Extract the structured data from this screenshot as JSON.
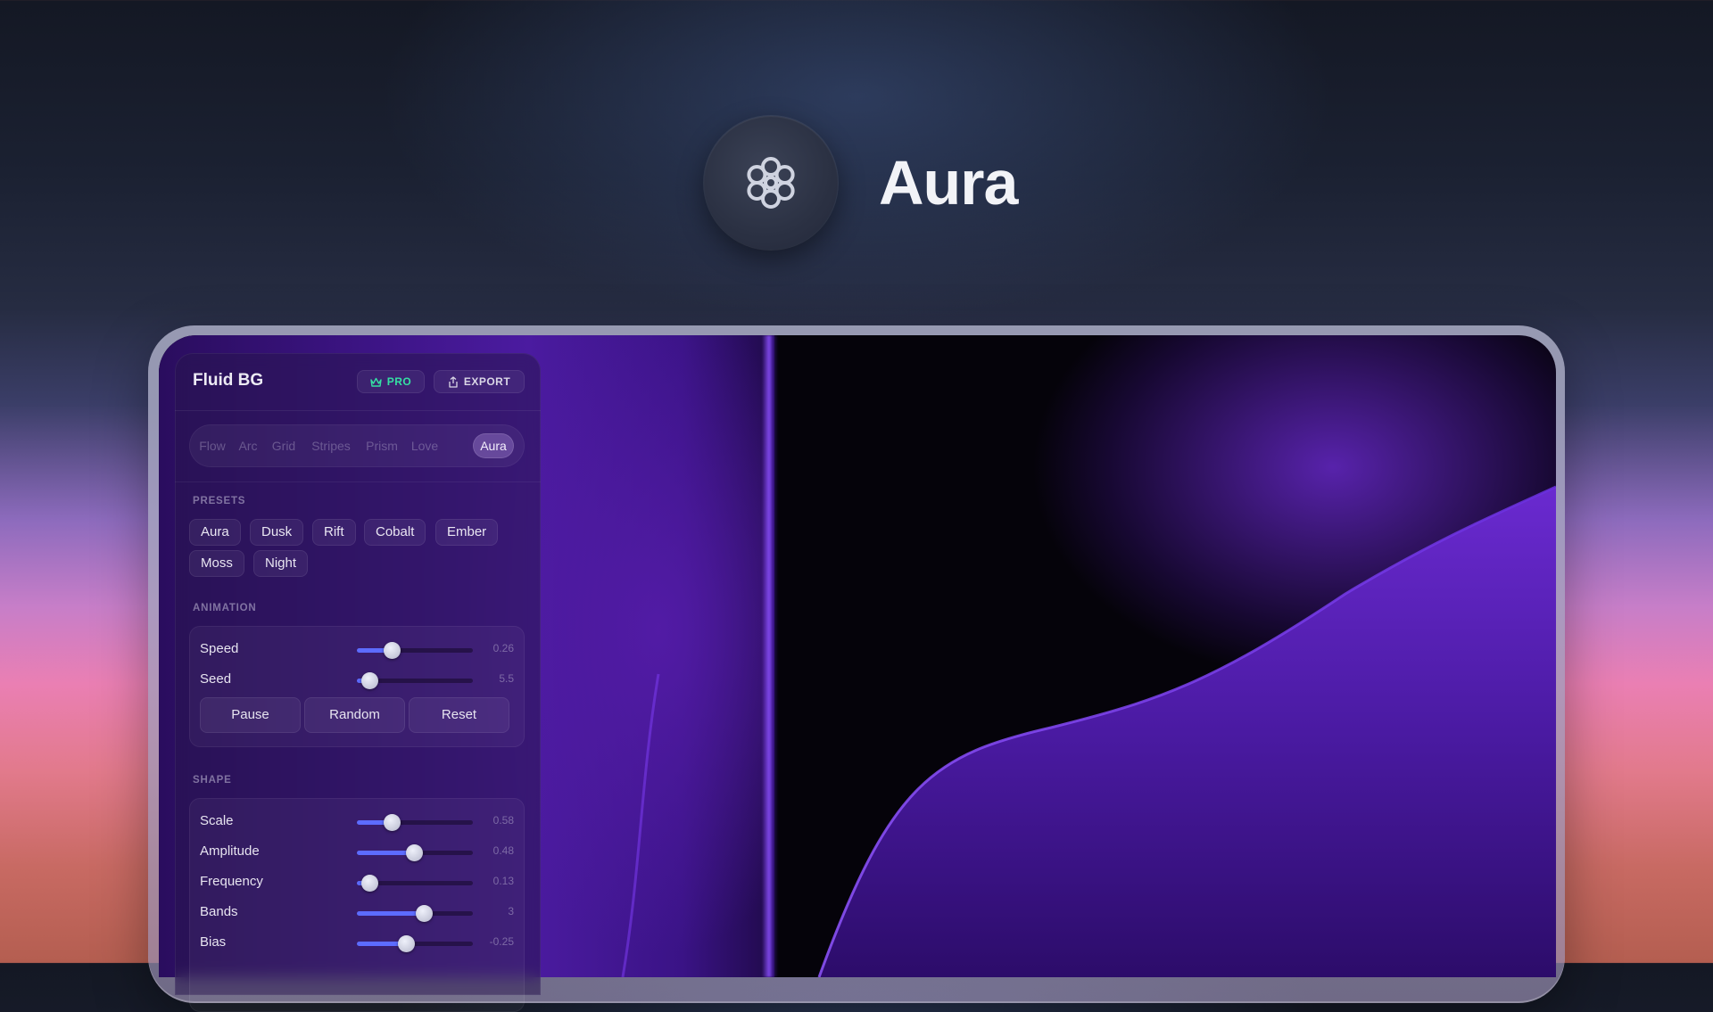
{
  "hero": {
    "title": "Aura",
    "icon": "flower-icon"
  },
  "app": {
    "title": "Fluid BG",
    "pro_label": "PRO",
    "export_label": "EXPORT",
    "accent": "#5d6cff",
    "pro_color": "#35e0a3"
  },
  "tabs": [
    "Flow",
    "Arc",
    "Grid",
    "Stripes",
    "Prism",
    "Love",
    "Aura"
  ],
  "active_tab": "Aura",
  "presets": {
    "label": "PRESETS",
    "items": [
      "Aura",
      "Dusk",
      "Rift",
      "Cobalt",
      "Ember",
      "Moss",
      "Night"
    ]
  },
  "animation": {
    "label": "ANIMATION",
    "sliders": [
      {
        "label": "Speed",
        "value": "0.26",
        "level": 0.3
      },
      {
        "label": "Seed",
        "value": "5.5",
        "level": 0.11
      }
    ],
    "buttons": [
      "Pause",
      "Random",
      "Reset"
    ]
  },
  "shape": {
    "label": "SHAPE",
    "sliders": [
      {
        "label": "Scale",
        "value": "0.58",
        "level": 0.3
      },
      {
        "label": "Amplitude",
        "value": "0.48",
        "level": 0.49
      },
      {
        "label": "Frequency",
        "value": "0.13",
        "level": 0.11
      },
      {
        "label": "Bands",
        "value": "3",
        "level": 0.58
      },
      {
        "label": "Bias",
        "value": "-0.25",
        "level": 0.42
      }
    ]
  }
}
